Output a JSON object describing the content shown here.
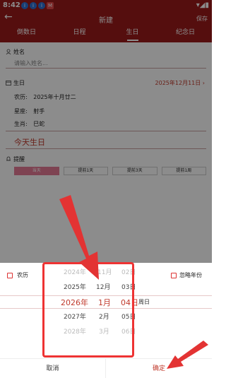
{
  "status_bar": {
    "time": "8:42",
    "notifs": [
      "i",
      "i",
      "i"
    ],
    "app_badge": "M",
    "right": "▾◢▮"
  },
  "header": {
    "title": "新建",
    "save": "保存"
  },
  "tabs": [
    {
      "label": "倒数日",
      "active": false
    },
    {
      "label": "日程",
      "active": false
    },
    {
      "label": "生日",
      "active": true
    },
    {
      "label": "纪念日",
      "active": false
    }
  ],
  "form": {
    "name_label": "姓名",
    "name_placeholder": "请输入姓名...",
    "birthday_label": "生日",
    "birthday_value": "2025年12月11日",
    "lunar_label": "农历:",
    "lunar_value": "2025年十月廿二",
    "zodiac_label": "星座:",
    "zodiac_value": "射手",
    "animal_label": "生肖:",
    "animal_value": "巳蛇",
    "today_text": "今天生日",
    "remind_label": "提醒",
    "remind_options": [
      {
        "label": "当天",
        "active": true
      },
      {
        "label": "提前1天",
        "active": false
      },
      {
        "label": "提前3天",
        "active": false
      },
      {
        "label": "提前1周",
        "active": false
      }
    ]
  },
  "sheet": {
    "lunar_toggle": "农历",
    "ignore_year_toggle": "忽略年份",
    "rows": [
      {
        "year": "2024年",
        "month": "11月",
        "day": "02日",
        "week": ""
      },
      {
        "year": "2025年",
        "month": "12月",
        "day": "03日",
        "week": ""
      },
      {
        "year": "2026年",
        "month": "1月",
        "day": "04日",
        "week": "周日"
      },
      {
        "year": "2027年",
        "month": "2月",
        "day": "05日",
        "week": ""
      },
      {
        "year": "2028年",
        "month": "3月",
        "day": "06日",
        "week": ""
      }
    ],
    "cancel": "取消",
    "confirm": "确定"
  },
  "colors": {
    "brand": "#9b1b1b",
    "accent": "#c0392b",
    "remind_active": "#e57b96",
    "annotation": "#e33333"
  },
  "icons": {
    "back": "back-arrow-icon",
    "person": "person-icon",
    "calendar": "calendar-icon",
    "bell": "bell-icon"
  }
}
